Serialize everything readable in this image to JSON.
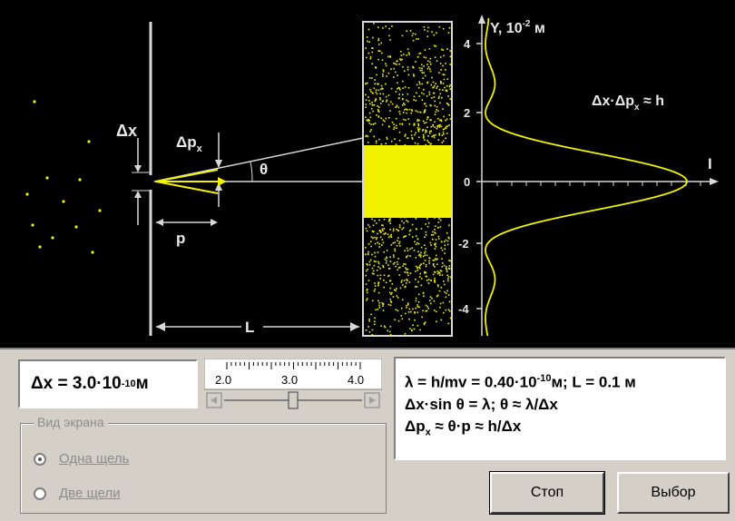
{
  "simulation": {
    "y_axis_label": "Y, 10",
    "y_axis_exp": "-2",
    "y_axis_unit": " м",
    "y_ticks": [
      "4",
      "2",
      "0",
      "-2",
      "-4"
    ],
    "i_axis_label": "I",
    "relation_label": "Δx·Δp",
    "relation_sub": "x",
    "relation_rest": " ≈ h",
    "dx_label": "Δx",
    "dpx_label": "Δp",
    "dpx_sub": "x",
    "theta_label": "θ",
    "p_label": "p",
    "l_label": "L"
  },
  "dx_display": {
    "prefix": "Δx = 3.0·10",
    "exp": "-10",
    "unit": " м"
  },
  "slider": {
    "tick_labels": [
      "2.0",
      "3.0",
      "4.0"
    ],
    "value": 3.0,
    "min": 1.5,
    "max": 4.5
  },
  "formulas": {
    "line1_a": "λ = h/mv = 0.40·10",
    "line1_exp": "-10",
    "line1_b": "м; L = 0.1 м",
    "line2": "Δx·sin θ  = λ; θ ≈ λ/Δx",
    "line3_a": "Δp",
    "line3_sub": "x",
    "line3_b": " ≈ θ·p  ≈ h/Δx"
  },
  "screen_view": {
    "title": "Вид экрана",
    "options": [
      "Одна щель",
      "Две щели"
    ],
    "selected": 0
  },
  "buttons": {
    "stop": "Стоп",
    "select": "Выбор"
  },
  "colors": {
    "beam": "#f2f200",
    "background": "#000000",
    "lines": "#d8d8d8"
  }
}
